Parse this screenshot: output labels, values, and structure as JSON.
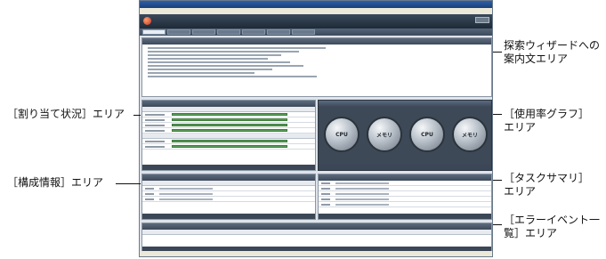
{
  "window": {
    "title": "",
    "menu": [
      "",
      "",
      "",
      "",
      "",
      "",
      ""
    ],
    "status": ""
  },
  "app": {
    "title": "",
    "subtitle": "",
    "user": "",
    "logout_label": ""
  },
  "tabs": [
    {
      "label": "",
      "active": true
    },
    {
      "label": "",
      "active": false
    },
    {
      "label": "",
      "active": false
    },
    {
      "label": "",
      "active": false
    },
    {
      "label": "",
      "active": false
    },
    {
      "label": "",
      "active": false
    },
    {
      "label": "",
      "active": false
    }
  ],
  "tab_right": [
    "",
    ""
  ],
  "panels": {
    "wizard": {
      "header": "",
      "title": ""
    },
    "allocation": {
      "header": "",
      "footer": ""
    },
    "usage": {
      "header": "",
      "footer": "",
      "gauges": [
        {
          "label": "CPU"
        },
        {
          "label": "メモリ"
        },
        {
          "label": "CPU"
        },
        {
          "label": "メモリ"
        }
      ]
    },
    "config": {
      "header": "",
      "footer": ""
    },
    "tasks": {
      "header": "",
      "footer": ""
    },
    "errors": {
      "header": "",
      "footer": ""
    }
  },
  "callouts": {
    "wizard": "探索ウィザードへの案内文エリア",
    "allocation": "［割り当て状況］エリア",
    "usage": "［使用率グラフ］エリア",
    "config": "［構成情報］エリア",
    "tasks": "［タスクサマリ］エリア",
    "errors": "［エラーイベント一覧］エリア"
  }
}
